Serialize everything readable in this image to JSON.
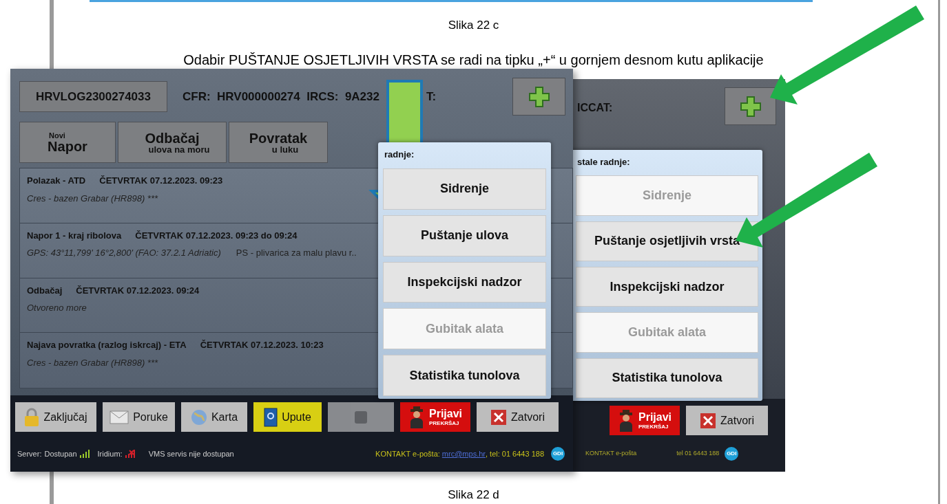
{
  "document": {
    "top_caption": "Slika 22 c",
    "instruction": "Odabir PUŠTANJE OSJETLJIVIH VRSTA se radi na tipku „+“ u gornjem desnom kutu aplikacije",
    "bottom_caption": "Slika 22 d"
  },
  "left_app": {
    "log_id": "HRVLOG2300274033",
    "vessel_info": "CFR:  HRV000000274  IRCS:  9A232",
    "vessel_info_tail": "T:",
    "actions": [
      {
        "kind": "small_first",
        "small": "Novi",
        "large": "Napor"
      },
      {
        "kind": "large_first",
        "large": "Odbačaj",
        "small": "ulova na moru"
      },
      {
        "kind": "large_first",
        "large": "Povratak",
        "small": "u luku"
      }
    ],
    "log": [
      {
        "title": "Polazak - ATD",
        "time": "ČETVRTAK 07.12.2023. 09:23",
        "detail": "Cres - bazen Grabar (HR898) ***"
      },
      {
        "title": "Napor 1 - kraj ribolova",
        "time": "ČETVRTAK 07.12.2023. 09:23 do 09:24",
        "detail": "GPS: 43°11,799' 16°2,800' (FAO: 37.2.1 Adriatic)",
        "note": "PS - plivarica za malu plavu r.."
      },
      {
        "title": "Odbačaj",
        "time": "ČETVRTAK 07.12.2023. 09:24",
        "detail": "Otvoreno more"
      },
      {
        "title": "Najava povratka (razlog iskrcaj) - ETA",
        "time": "ČETVRTAK 07.12.2023. 10:23",
        "detail": "Cres - bazen Grabar (HR898) ***"
      }
    ],
    "menu": {
      "header": "radnje:",
      "items": [
        {
          "label": "Sidrenje",
          "disabled": false
        },
        {
          "label": "Puštanje ulova",
          "disabled": false
        },
        {
          "label": "Inspekcijski nadzor",
          "disabled": false
        },
        {
          "label": "Gubitak alata",
          "disabled": true
        },
        {
          "label": "Statistika tunolova",
          "disabled": false
        }
      ]
    },
    "toolbar": [
      {
        "kind": "lock",
        "label": "Zaključaj",
        "disabled": false
      },
      {
        "kind": "mail",
        "label": "Poruke",
        "disabled": false
      },
      {
        "kind": "globe",
        "label": "Karta",
        "disabled": false
      },
      {
        "kind": "help",
        "label": "Upute",
        "disabled": false
      },
      {
        "kind": "blank",
        "disabled": true
      },
      {
        "kind": "report",
        "label": "Prijavi",
        "sublabel": "PREKRŠAJ",
        "disabled": false
      },
      {
        "kind": "close",
        "label": "Zatvori",
        "disabled": false
      }
    ],
    "status": {
      "server_label": "Server:",
      "server_value": "Dostupan",
      "server_online": true,
      "iridium_label": "Iridium:",
      "iridium_online": false,
      "vms": "VMS servis nije dostupan",
      "contact_label": "KONTAKT e-pošta:",
      "email": "mrc@mps.hr",
      "phone": ", tel: 01 6443 188",
      "logo": "GDI"
    }
  },
  "right_app": {
    "vessel_info": "ICCAT:",
    "menu": {
      "header": "stale radnje:",
      "items": [
        {
          "label": "Sidrenje",
          "disabled": true
        },
        {
          "label": "Puštanje osjetljivih vrsta",
          "disabled": false
        },
        {
          "label": "Inspekcijski nadzor",
          "disabled": false
        },
        {
          "label": "Gubitak alata",
          "disabled": true
        },
        {
          "label": "Statistika tunolova",
          "disabled": false
        }
      ]
    },
    "toolbar": [
      {
        "kind": "report",
        "label": "Prijavi",
        "sublabel": "PREKRŠAJ",
        "disabled": false
      },
      {
        "kind": "close",
        "label": "Zatvori",
        "disabled": false
      }
    ],
    "status": {
      "contact_label": "KONTAKT e-pošta",
      "phone": "tel 01 6443 188",
      "logo": "GDI"
    }
  }
}
